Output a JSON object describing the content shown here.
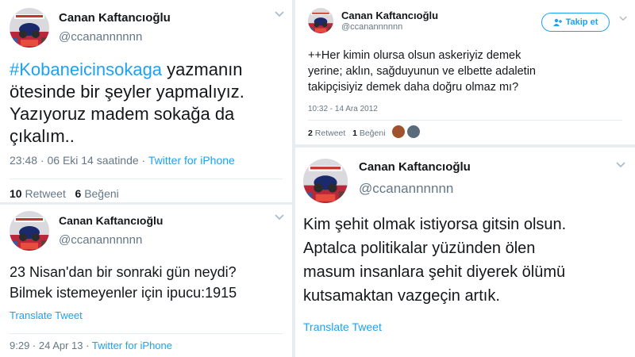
{
  "tweet_a": {
    "name": "Canan Kaftancıoğlu",
    "handle": "@ccanannnnnn",
    "hashtag": "#Kobaneicinsokaga",
    "text_l1_rest": " yazmanın",
    "text_l2": "ötesinde bir şeyler yapmalıyız.",
    "text_l3": "Yazıyoruz madem sokağa da",
    "text_l4": "çıkalım..",
    "timestamp": "23:48 · 06 Eki 14 saatinde ·",
    "source": "Twitter for iPhone",
    "retweet_count": "10",
    "retweet_label": "Retweet",
    "like_count": "6",
    "like_label": "Beğeni"
  },
  "tweet_b": {
    "name": "Canan Kaftancıoğlu",
    "handle": "@ccanannnnnn",
    "text_l1": "23 Nisan'dan bir sonraki gün neydi?",
    "text_l2": "Bilmek istemeyenler için ipucu:1915",
    "translate": "Translate Tweet",
    "timestamp": "9:29 · 24 Apr 13 ·",
    "source": "Twitter for iPhone"
  },
  "tweet_c": {
    "name": "Canan Kaftancıoğlu",
    "handle": "@ccanannnnnn",
    "follow_label": "Takip et",
    "text_l1": "++Her kimin olursa olsun askeriyiz demek",
    "text_l2": "yerine; aklın, sağduyunun ve elbette adaletin",
    "text_l3": "takipçisiyiz demek daha  doğru olmaz mı?",
    "timestamp": "10:32 - 14 Ara 2012",
    "retweet_count": "2",
    "retweet_label": "Retweet",
    "like_count": "1",
    "like_label": "Beğeni"
  },
  "tweet_d": {
    "name": "Canan Kaftancıoğlu",
    "handle": "@ccanannnnnn",
    "text_l1": "Kim şehit olmak istiyorsa gitsin olsun.",
    "text_l2": "Aptalca politikalar yüzünden ölen",
    "text_l3": "masum insanlara şehit diyerek ölümü",
    "text_l4": "kutsamaktan vazgeçin artık.",
    "translate": "Translate Tweet"
  },
  "colors": {
    "link": "#1da1f2",
    "muted": "#657786",
    "text": "#14171a"
  },
  "icons": [
    "avatar-image",
    "chevron-down-icon",
    "follow-person-icon"
  ]
}
